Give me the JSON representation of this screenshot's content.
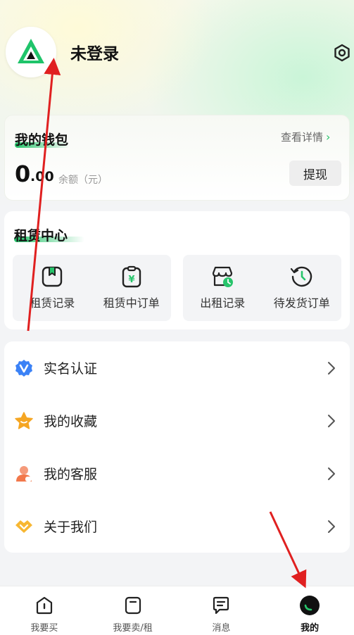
{
  "profile": {
    "username": "未登录",
    "avatar_icon": "brand-logo-icon",
    "settings_icon": "settings-icon"
  },
  "wallet": {
    "title": "我的钱包",
    "detail_link": "查看详情",
    "balance_integer": "0",
    "balance_decimal": ".00",
    "balance_label": "余额（元）",
    "withdraw_label": "提现"
  },
  "rental_center": {
    "title": "租赁中心",
    "items": [
      {
        "label": "租赁记录",
        "icon": "bookmark-box-icon"
      },
      {
        "label": "租赁中订单",
        "icon": "yen-clipboard-icon"
      },
      {
        "label": "出租记录",
        "icon": "store-clock-icon"
      },
      {
        "label": "待发货订单",
        "icon": "history-clock-icon"
      }
    ]
  },
  "menu": {
    "items": [
      {
        "label": "实名认证",
        "icon": "verified-badge-icon"
      },
      {
        "label": "我的收藏",
        "icon": "star-icon"
      },
      {
        "label": "我的客服",
        "icon": "customer-service-icon"
      },
      {
        "label": "关于我们",
        "icon": "handshake-icon"
      }
    ]
  },
  "tabbar": {
    "items": [
      {
        "label": "我要买",
        "icon": "buy-icon"
      },
      {
        "label": "我要卖/租",
        "icon": "sell-rent-icon"
      },
      {
        "label": "消息",
        "icon": "message-icon"
      },
      {
        "label": "我的",
        "icon": "profile-icon"
      }
    ],
    "active_index": 3
  },
  "colors": {
    "accent_green": "#27c46b",
    "annotation_red": "#e02020"
  }
}
